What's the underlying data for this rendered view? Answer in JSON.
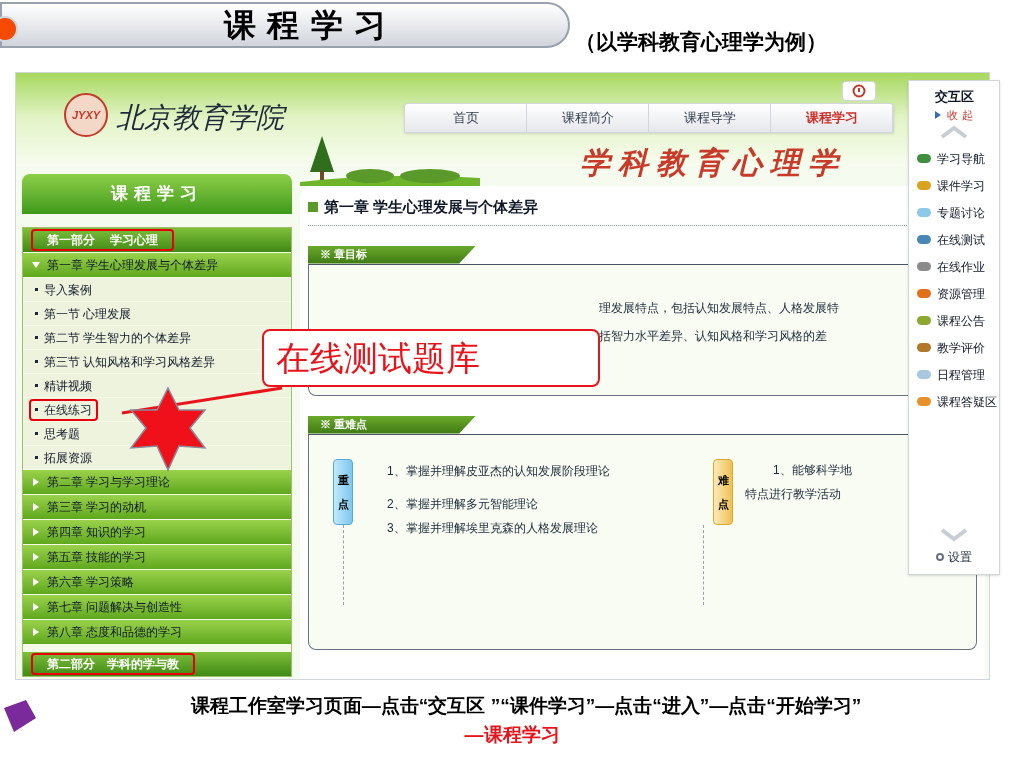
{
  "slide": {
    "title": "课 程 学 习",
    "subtitle": "（以学科教育心理学为例）"
  },
  "site": {
    "school_name": "北京教育学院",
    "logo_text": "JYXY",
    "nav_tabs": [
      {
        "label": "首页",
        "selected": false
      },
      {
        "label": "课程简介",
        "selected": false
      },
      {
        "label": "课程导学",
        "selected": false
      },
      {
        "label": "课程学习",
        "selected": true
      }
    ],
    "banner_title": "学科教育心理学"
  },
  "sidebar": {
    "title": "课程学习",
    "items": [
      {
        "kind": "part",
        "label": "第一部分　 学习心理",
        "highlighted": true
      },
      {
        "kind": "chapter",
        "label": "第一章 学生心理发展与个体差异",
        "expanded": true,
        "children": [
          {
            "label": "导入案例",
            "highlighted": false
          },
          {
            "label": "第一节 心理发展",
            "highlighted": false
          },
          {
            "label": "第二节 学生智力的个体差异",
            "highlighted": false
          },
          {
            "label": "第三节 认知风格和学习风格差异",
            "highlighted": false
          },
          {
            "label": "精讲视频",
            "highlighted": false
          },
          {
            "label": "在线练习",
            "highlighted": true
          },
          {
            "label": "思考题",
            "highlighted": false
          },
          {
            "label": "拓展资源",
            "highlighted": false
          }
        ]
      },
      {
        "kind": "chapter",
        "label": "第二章 学习与学习理论",
        "expanded": false
      },
      {
        "kind": "chapter",
        "label": "第三章 学习的动机",
        "expanded": false
      },
      {
        "kind": "chapter",
        "label": "第四章 知识的学习",
        "expanded": false
      },
      {
        "kind": "chapter",
        "label": "第五章 技能的学习",
        "expanded": false
      },
      {
        "kind": "chapter",
        "label": "第六章 学习策略",
        "expanded": false
      },
      {
        "kind": "chapter",
        "label": "第七章 问题解决与创造性",
        "expanded": false
      },
      {
        "kind": "chapter",
        "label": "第八章 态度和品德的学习",
        "expanded": false
      },
      {
        "kind": "part",
        "label": "第二部分　学科的学与教",
        "highlighted": true
      }
    ]
  },
  "content": {
    "chapter_title": "第一章 学生心理发展与个体差异",
    "goals": {
      "heading": "※ 章目标",
      "lines": [
        "理发展特点，包括认知发展特点、人格发展特",
        "括智力水平差异、认知风格和学习风格的差"
      ]
    },
    "key_points": {
      "heading": "※ 重难点",
      "key_label": "重点",
      "key_lines": [
        "1、掌握并理解皮亚杰的认知发展阶段理论",
        "2、掌握并理解多元智能理论",
        "3、掌握并理解埃里克森的人格发展理论"
      ],
      "hard_label": "难点",
      "hard_lines": [
        "1、能够科学地",
        "特点进行教学活动"
      ]
    }
  },
  "interaction_panel": {
    "title": "交互区",
    "collapse": "收 起",
    "items": [
      {
        "label": "学习导航",
        "color": "#3f8f3f"
      },
      {
        "label": "课件学习",
        "color": "#d9a21f"
      },
      {
        "label": "专题讨论",
        "color": "#8cc8e8"
      },
      {
        "label": "在线测试",
        "color": "#4a86b8"
      },
      {
        "label": "在线作业",
        "color": "#8a8a8a"
      },
      {
        "label": "资源管理",
        "color": "#e0701a"
      },
      {
        "label": "课程公告",
        "color": "#8aa832"
      },
      {
        "label": "教学评价",
        "color": "#b0782a"
      },
      {
        "label": "日程管理",
        "color": "#a8c8e0"
      },
      {
        "label": "课程答疑区",
        "color": "#e8902a"
      }
    ],
    "settings": "设置"
  },
  "callout": {
    "text": "在线测试题库"
  },
  "caption": {
    "text": "课程工作室学习页面—点击“交互区 ”“课件学习”—点击“进入”—点击“开始学习”",
    "link": "—课程学习"
  }
}
